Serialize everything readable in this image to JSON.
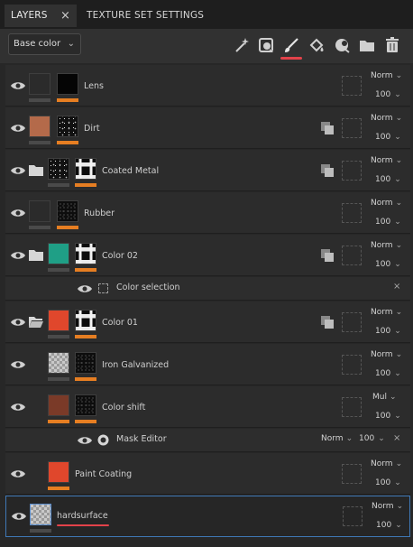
{
  "tabs": [
    {
      "label": "LAYERS",
      "close": "×"
    },
    {
      "label": "TEXTURE SET SETTINGS"
    }
  ],
  "toolbar": {
    "blend_mode": "Base color",
    "tools": [
      "magic-wand-icon",
      "mask-effect-icon",
      "paint-brush-icon",
      "fill-bucket-icon",
      "smart-material-icon",
      "folder-icon",
      "trash-icon"
    ],
    "active_tool": "paint-brush-icon"
  },
  "colors": {
    "accent_bar": "#e67e22",
    "selection_border": "#3f78b6",
    "underline": "#e3424a"
  },
  "layers": [
    {
      "name": "Lens",
      "blend": "Norm",
      "opacity": "100"
    },
    {
      "name": "Dirt",
      "blend": "Norm",
      "opacity": "100"
    },
    {
      "name": "Coated Metal",
      "blend": "Norm",
      "opacity": "100"
    },
    {
      "name": "Rubber",
      "blend": "Norm",
      "opacity": "100"
    },
    {
      "name": "Color 02",
      "blend": "Norm",
      "opacity": "100"
    },
    {
      "name": "Color selection"
    },
    {
      "name": "Color 01",
      "blend": "Norm",
      "opacity": "100"
    },
    {
      "name": "Iron Galvanized",
      "blend": "Norm",
      "opacity": "100"
    },
    {
      "name": "Color shift",
      "blend": "Mul",
      "opacity": "100"
    },
    {
      "name": "Mask Editor",
      "blend": "Norm",
      "opacity": "100"
    },
    {
      "name": "Paint Coating",
      "blend": "Norm",
      "opacity": "100"
    },
    {
      "name": "hardsurface",
      "blend": "Norm",
      "opacity": "100"
    }
  ],
  "chev": "⌄",
  "close_x": "×"
}
